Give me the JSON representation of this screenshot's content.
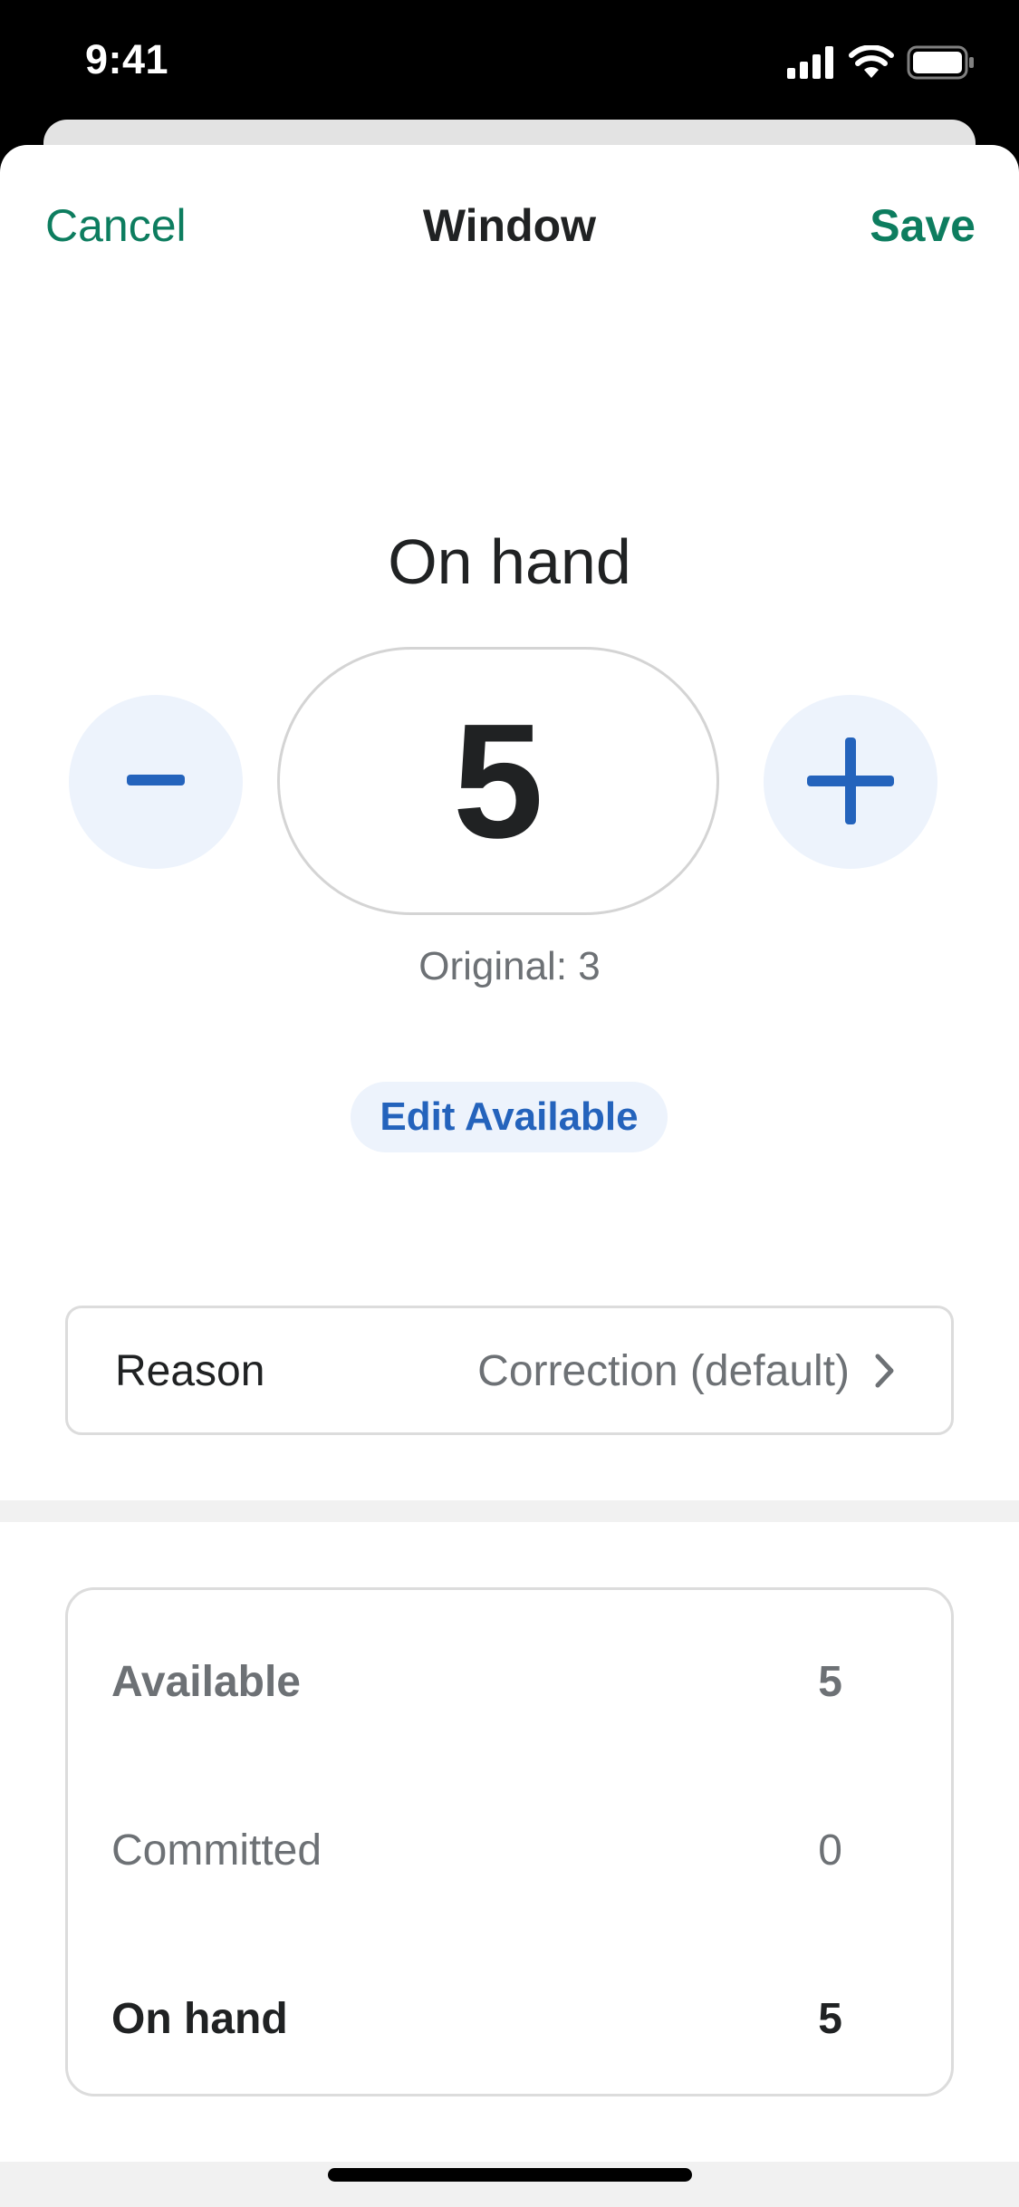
{
  "status_bar": {
    "time": "9:41",
    "icons": [
      "cellular-signal-icon",
      "wifi-icon",
      "battery-icon"
    ]
  },
  "nav": {
    "cancel_label": "Cancel",
    "title": "Window",
    "save_label": "Save"
  },
  "quantity": {
    "heading": "On hand",
    "value": "5",
    "original_text": "Original: 3",
    "decrement_icon": "minus-icon",
    "increment_icon": "plus-icon"
  },
  "edit_available_label": "Edit Available",
  "reason": {
    "label": "Reason",
    "value": "Correction (default)"
  },
  "summary": {
    "rows": [
      {
        "label": "Available",
        "value": "5"
      },
      {
        "label": "Committed",
        "value": "0"
      },
      {
        "label": "On hand",
        "value": "5"
      }
    ]
  },
  "colors": {
    "accent_green": "#0d7d5f",
    "accent_blue": "#2463bc",
    "stepper_bg": "#edf3fc",
    "text_primary": "#202223",
    "text_secondary": "#6d7175"
  }
}
